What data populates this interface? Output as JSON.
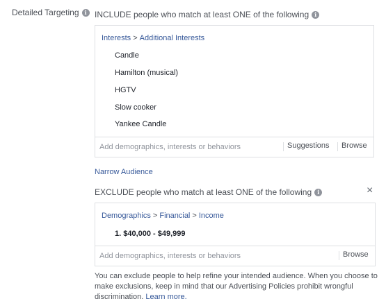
{
  "section_label": "Detailed Targeting",
  "include": {
    "header": "INCLUDE people who match at least ONE of the following",
    "breadcrumb": [
      "Interests",
      "Additional Interests"
    ],
    "breadcrumb_separator": ">",
    "items": [
      "Candle",
      "Hamilton (musical)",
      "HGTV",
      "Slow cooker",
      "Yankee Candle"
    ],
    "search_placeholder": "Add demographics, interests or behaviors",
    "suggestions_label": "Suggestions",
    "browse_label": "Browse"
  },
  "narrow_audience_label": "Narrow Audience",
  "exclude": {
    "header": "EXCLUDE people who match at least ONE of the following",
    "breadcrumb": [
      "Demographics",
      "Financial",
      "Income"
    ],
    "breadcrumb_separator": ">",
    "items": [
      "1. $40,000 - $49,999"
    ],
    "search_placeholder": "Add demographics, interests or behaviors",
    "browse_label": "Browse",
    "close_glyph": "×"
  },
  "help": {
    "text": "You can exclude people to help refine your intended audience. When you choose to make exclusions, keep in mind that our Advertising Policies prohibit wrongful discrimination.",
    "link_label": "Learn more."
  },
  "info_glyph": "i",
  "icons": {
    "info": "info-icon",
    "close": "close-icon"
  },
  "colors": {
    "link": "#365899",
    "text": "#4b4f56",
    "border": "#dddfe2",
    "placeholder": "#90949c"
  }
}
